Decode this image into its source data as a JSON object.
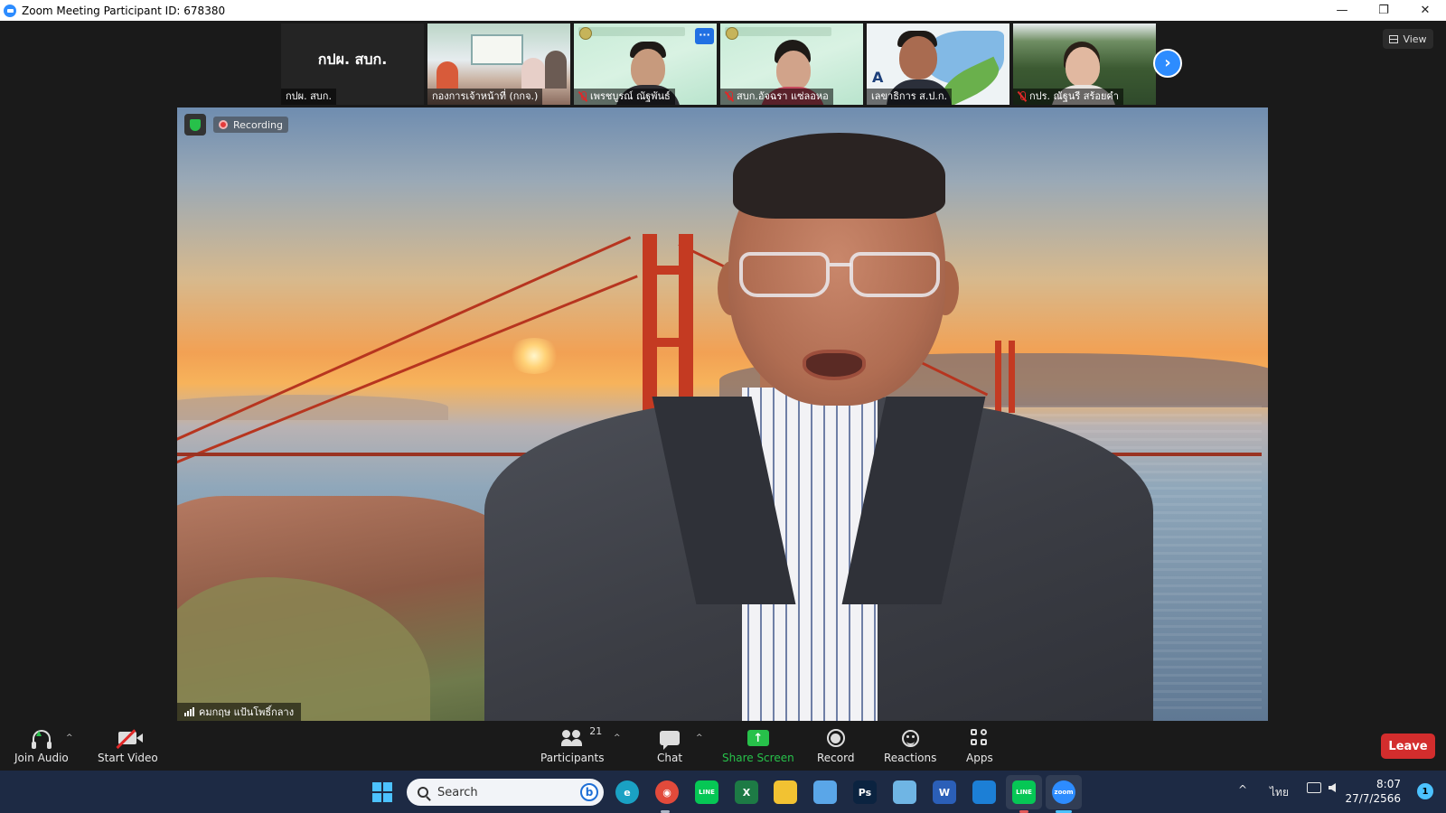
{
  "window": {
    "title": "Zoom Meeting Participant ID: 678380",
    "minimize": "—",
    "restore": "❐",
    "close": "✕"
  },
  "thumbnails": [
    {
      "name": "กปผ. สบก.",
      "big_text": "กปผ. สบก.",
      "muted": false
    },
    {
      "name": "กองการเจ้าหน้าที่ (กกจ.)",
      "muted": false
    },
    {
      "name": "เพรชบูรณ์ ณัฐพันธ์",
      "muted": true
    },
    {
      "name": "สบก.อัจฉรา แซ่ลอหอ",
      "muted": true
    },
    {
      "name": "เลขาธิการ ส.ป.ก.",
      "muted": false,
      "logo_text": "A"
    },
    {
      "name": "กปร. ณัฐนรี สร้อยคำ",
      "muted": true
    }
  ],
  "thumbnail_more": "···",
  "next_button": "›",
  "view_button": "View",
  "main": {
    "recording_label": "Recording",
    "speaker_name": "คมกฤษ แป้นโพธิ์กลาง"
  },
  "toolbar": {
    "join_audio": "Join Audio",
    "start_video": "Start Video",
    "participants": "Participants",
    "participant_count": "21",
    "chat": "Chat",
    "share_screen": "Share Screen",
    "share_arrow": "↑",
    "record": "Record",
    "reactions": "Reactions",
    "apps": "Apps",
    "leave": "Leave",
    "caret": "^"
  },
  "taskbar": {
    "search_placeholder": "Search",
    "bing_letter": "b",
    "apps": [
      {
        "name": "edge",
        "label": "e",
        "color": "#1aa1c4"
      },
      {
        "name": "chrome",
        "label": "◉",
        "color": "#e24a3b"
      },
      {
        "name": "line",
        "label": "LINE",
        "color": "#06c755"
      },
      {
        "name": "excel",
        "label": "X",
        "color": "#1d7a45"
      },
      {
        "name": "file-explorer",
        "label": "",
        "color": "#f2c232"
      },
      {
        "name": "notepad",
        "label": "",
        "color": "#5aa6e8"
      },
      {
        "name": "photoshop",
        "label": "Ps",
        "color": "#0b2340"
      },
      {
        "name": "photos",
        "label": "",
        "color": "#6fb5e4"
      },
      {
        "name": "word",
        "label": "W",
        "color": "#2b5fb8"
      },
      {
        "name": "window-app",
        "label": "",
        "color": "#1c7fd6"
      },
      {
        "name": "line-active",
        "label": "LINE",
        "color": "#06c755"
      },
      {
        "name": "zoom",
        "label": "zoom",
        "color": "#2d8cff"
      }
    ],
    "tray_chevron": "^",
    "language": "ไทย",
    "time": "8:07",
    "date": "27/7/2566",
    "notifications": "1"
  },
  "colors": {
    "zoom_blue": "#2d8cff",
    "leave_red": "#d32d2d",
    "share_green": "#27c14a",
    "taskbar_bg": "#1d2a44"
  }
}
